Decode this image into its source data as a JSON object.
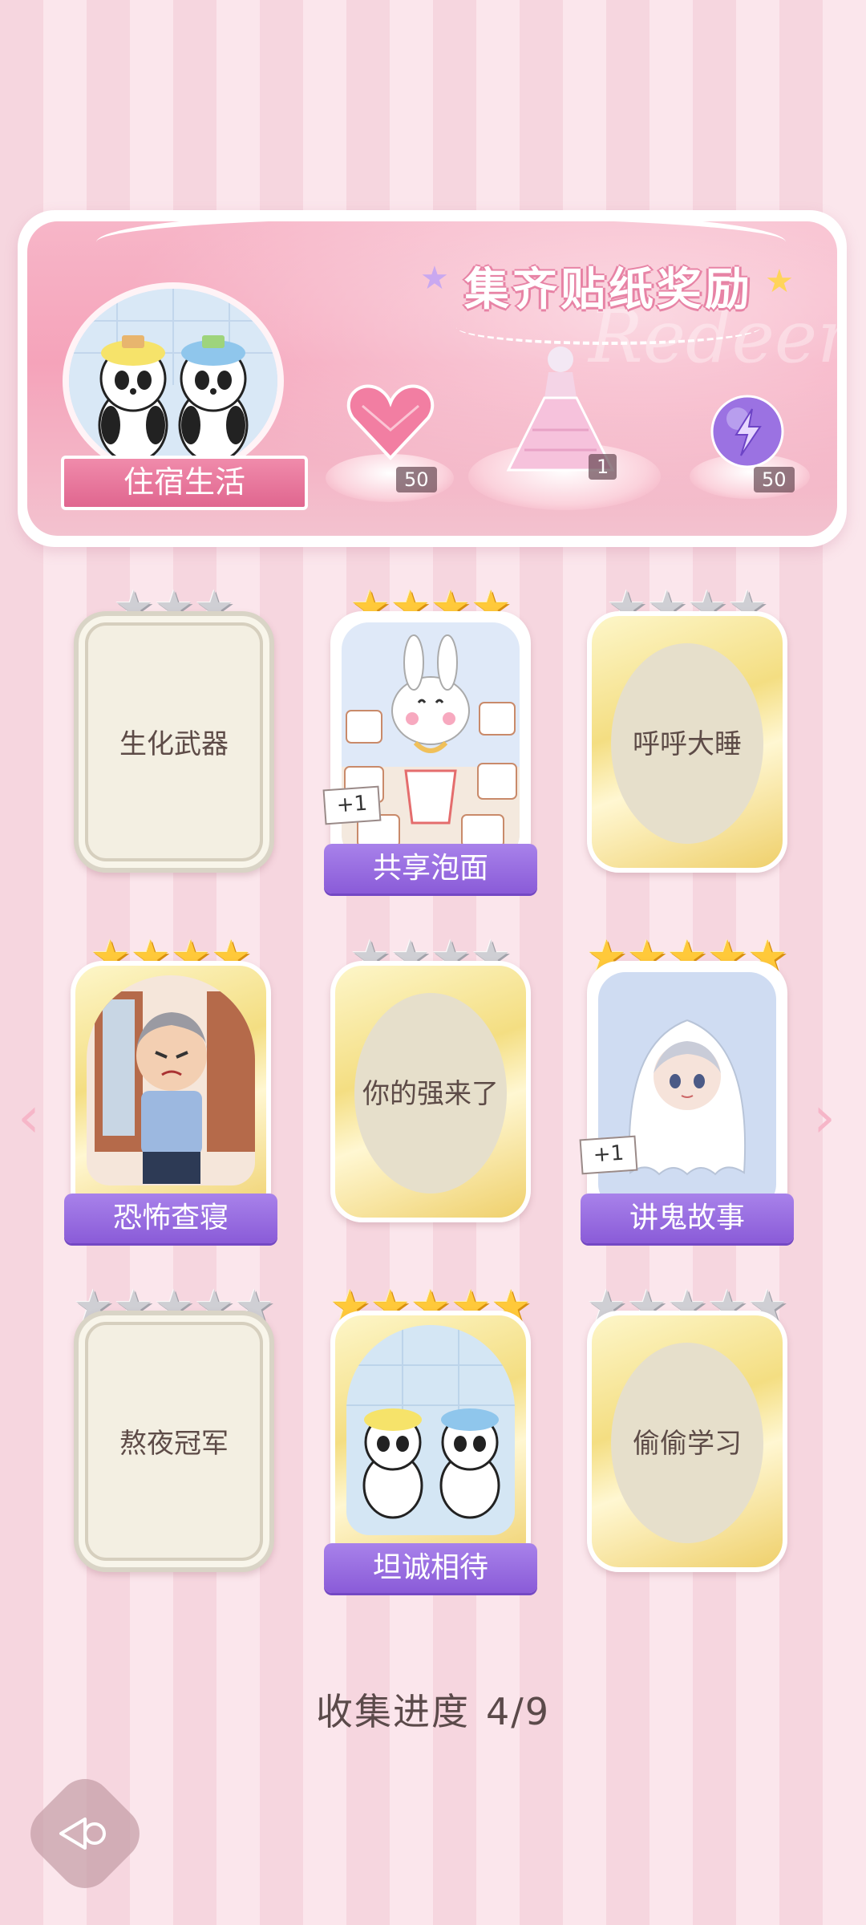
{
  "banner": {
    "title": "集齐贴纸奖励",
    "watermark": "Redeem",
    "theme_label": "住宿生活",
    "rewards": [
      {
        "icon": "pink-heart-gem-icon",
        "count": "50"
      },
      {
        "icon": "pink-dress-outfit-icon",
        "count": "1"
      },
      {
        "icon": "purple-energy-orb-icon",
        "count": "50"
      }
    ]
  },
  "stickers": [
    {
      "label": "生化武器",
      "owned": false,
      "frame": "plain",
      "stars": 3,
      "gold_stars": 0
    },
    {
      "label": "共享泡面",
      "owned": true,
      "frame": "owned",
      "stars": 4,
      "gold_stars": 4,
      "plus": "+1"
    },
    {
      "label": "呼呼大睡",
      "owned": false,
      "frame": "gold",
      "stars": 4,
      "gold_stars": 0
    },
    {
      "label": "恐怖查寝",
      "owned": true,
      "frame": "gold",
      "stars": 4,
      "gold_stars": 4
    },
    {
      "label": "你的强来了",
      "owned": false,
      "frame": "gold",
      "stars": 4,
      "gold_stars": 0
    },
    {
      "label": "讲鬼故事",
      "owned": true,
      "frame": "owned",
      "stars": 5,
      "gold_stars": 5,
      "plus": "+1"
    },
    {
      "label": "熬夜冠军",
      "owned": false,
      "frame": "plain",
      "stars": 5,
      "gold_stars": 0
    },
    {
      "label": "坦诚相待",
      "owned": true,
      "frame": "gold",
      "stars": 5,
      "gold_stars": 5
    },
    {
      "label": "偷偷学习",
      "owned": false,
      "frame": "gold",
      "stars": 5,
      "gold_stars": 0
    }
  ],
  "progress": {
    "label": "收集进度",
    "value": "4/9"
  },
  "nav": {
    "prev_icon": "chevron-left-icon",
    "next_icon": "chevron-right-icon",
    "back_icon": "back-icon"
  }
}
